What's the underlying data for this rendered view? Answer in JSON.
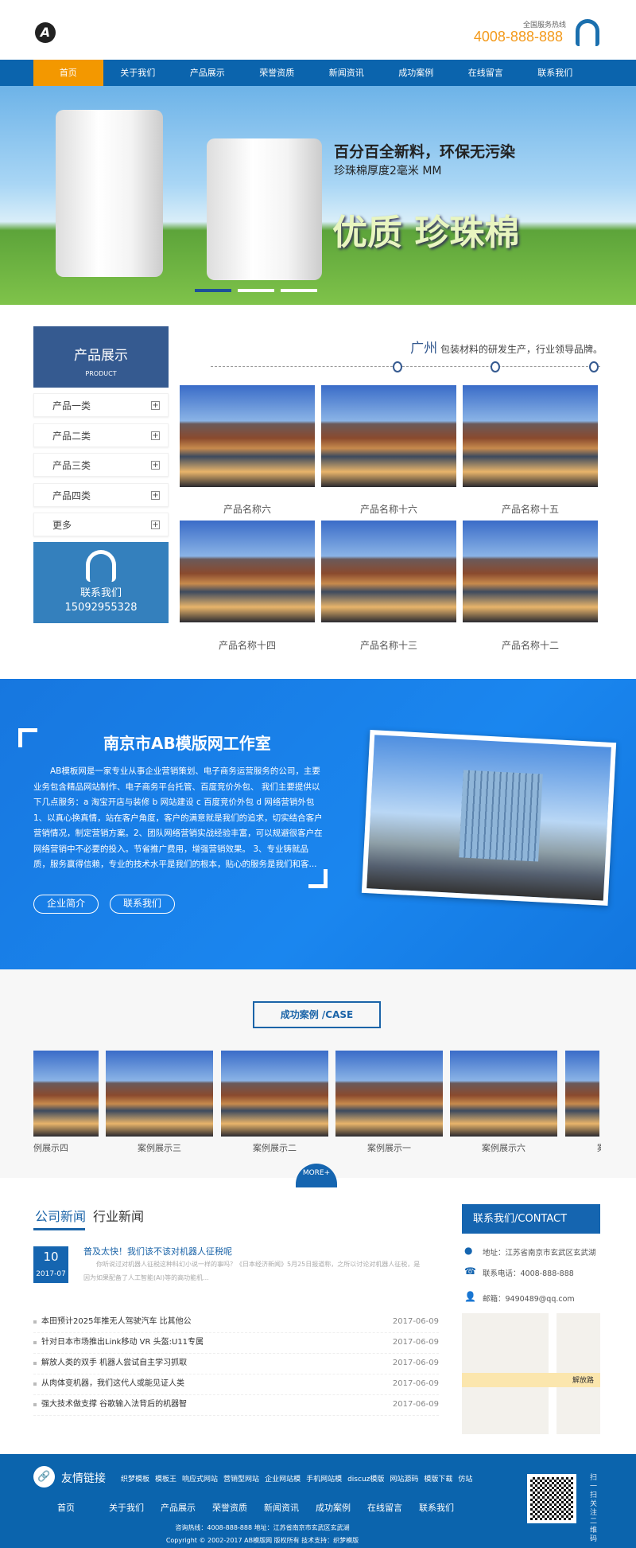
{
  "header": {
    "logo": "A",
    "hotline_label": "全国服务热线",
    "hotline": "4008-888-888"
  },
  "nav": [
    "首页",
    "关于我们",
    "产品展示",
    "荣誉资质",
    "新闻资讯",
    "成功案例",
    "在线留言",
    "联系我们"
  ],
  "banner": {
    "line1": "百分百全新料，环保无污染",
    "line2": "珍珠棉厚度2毫米 MM",
    "line3": "优质 珍珠棉"
  },
  "sidebar": {
    "title": "产品展示",
    "subtitle": "PRODUCT",
    "items": [
      "产品一类",
      "产品二类",
      "产品三类",
      "产品四类",
      "更多"
    ],
    "contact_label": "联系我们",
    "contact_phone": "15092955328"
  },
  "slogan": {
    "city": "广州",
    "text": " 包装材料的研发生产，行业领导品牌。"
  },
  "products": [
    "产品名称六",
    "产品名称十六",
    "产品名称十五",
    "产品名称十四",
    "产品名称十三",
    "产品名称十二"
  ],
  "about": {
    "title": "南京市AB模版网工作室",
    "text": "AB模板网是一家专业从事企业营销策划、电子商务运营服务的公司，主要业务包含精品网站制作、电子商务平台托管、百度竞价外包、 我们主要提供以下几点服务：a 淘宝开店与装修 b 网站建设 c 百度竞价外包 d 网络营销外包 1、以真心换真情，站在客户角度，客户的满意就是我们的追求，切实结合客户营销情况，制定营销方案。2、团队网络营销实战经验丰富，可以规避很客户在网络营销中不必要的投入。节省推广费用，增强营销效果。 3、专业铸就品质，服务赢得信赖，专业的技术水平是我们的根本，贴心的服务是我们和客...",
    "btn1": "企业简介",
    "btn2": "联系我们"
  },
  "cases": {
    "title": "成功案例  /CASE",
    "items": [
      "例展示四",
      "案例展示三",
      "案例展示二",
      "案例展示一",
      "案例展示六",
      "案"
    ],
    "more": "MORE+"
  },
  "news": {
    "tabs": [
      "公司新闻",
      "行业新闻"
    ],
    "featured": {
      "day": "10",
      "month": "2017-07",
      "title": "普及太快！我们该不该对机器人征税呢",
      "summary": "你听说过对机器人征税这种科幻小说一样的事吗？《日本经济新闻》5月25日报道称，之所以讨论对机器人征税，是因为如果配备了人工智能(AI)等的高功能机..."
    },
    "list": [
      {
        "title": "本田预计2025年推无人驾驶汽车 比其他公",
        "date": "2017-06-09"
      },
      {
        "title": "针对日本市场推出Link移动 VR 头盔:U11专属",
        "date": "2017-06-09"
      },
      {
        "title": "解放人类的双手 机器人尝试自主学习抓取",
        "date": "2017-06-09"
      },
      {
        "title": "从肉体变机器，我们这代人或能见证人类",
        "date": "2017-06-09"
      },
      {
        "title": "强大技术做支撑 谷歌输入法背后的机器智",
        "date": "2017-06-09"
      }
    ]
  },
  "contact": {
    "title": "联系我们/CONTACT",
    "address": "地址：江苏省南京市玄武区玄武湖",
    "phone": "联系电话：4008-888-888",
    "email": "邮箱：9490489@qq.com",
    "map_road": "解放路"
  },
  "footer": {
    "links_label": "友情链接",
    "links": [
      "织梦模板",
      "模板王",
      "响应式网站",
      "营销型网站",
      "企业网站模",
      "手机网站模",
      "discuz模版",
      "网站源码",
      "模版下载",
      "仿站"
    ],
    "nav": [
      "首页",
      "关于我们",
      "产品展示",
      "荣誉资质",
      "新闻资讯",
      "成功案例",
      "在线留言",
      "联系我们"
    ],
    "info": "咨询热线：4008-888-888 地址：江苏省南京市玄武区玄武湖",
    "copyright": "Copyright © 2002-2017 AB模版网 版权所有 技术支持：织梦模版",
    "qr_text": "扫一扫关注二维码"
  },
  "colors": {
    "nav": "#0b64ad",
    "accent": "#f39800",
    "sidebar": "#355a90",
    "about_bg": "#1a86ef"
  }
}
